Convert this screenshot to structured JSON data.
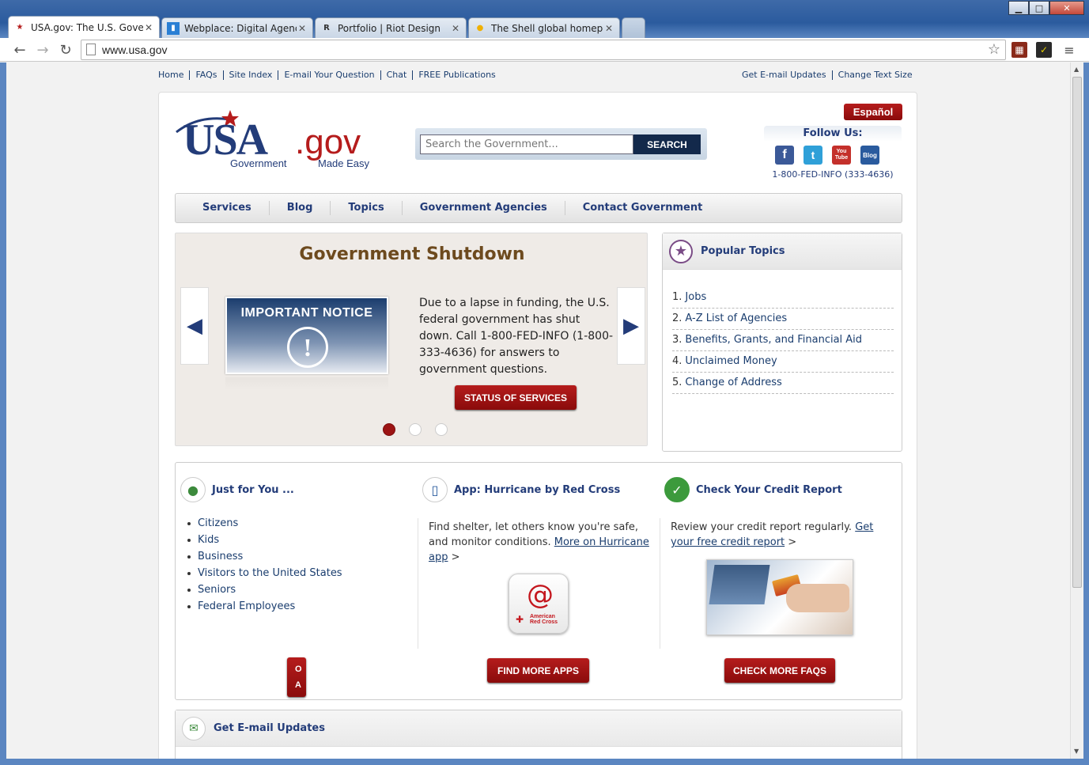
{
  "browser": {
    "tabs": [
      {
        "title": "USA.gov: The U.S. Govern",
        "active": true,
        "favicon": "usagov-favicon"
      },
      {
        "title": "Webplace: Digital Agency",
        "active": false,
        "favicon": "webplace-favicon"
      },
      {
        "title": "Portfolio | Riot Design",
        "active": false,
        "favicon": "riot-favicon"
      },
      {
        "title": "The Shell global homepag",
        "active": false,
        "favicon": "shell-favicon"
      }
    ],
    "url": "www.usa.gov",
    "window_controls": {
      "minimize": "▁",
      "maximize": "□",
      "close": "✕"
    }
  },
  "utility_nav": {
    "left": [
      "Home",
      "FAQs",
      "Site Index",
      "E-mail Your Question",
      "Chat",
      "FREE Publications"
    ],
    "right": [
      "Get E-mail Updates",
      "Change Text Size"
    ]
  },
  "header": {
    "espanol": "Español",
    "logo": {
      "usa": "USA",
      "gov": ".gov",
      "tag_left": "Government",
      "tag_right": "Made Easy"
    },
    "search": {
      "placeholder": "Search the Government...",
      "button": "SEARCH"
    },
    "follow": {
      "title": "Follow Us:",
      "phone": "1-800-FED-INFO (333-4636)",
      "icons": [
        "facebook-icon",
        "twitter-icon",
        "youtube-icon",
        "blog-icon"
      ],
      "youtube_label": "You Tube",
      "blog_label": "Blog"
    }
  },
  "main_nav": [
    "Services",
    "Blog",
    "Topics",
    "Government Agencies",
    "Contact Government"
  ],
  "hero": {
    "title": "Government Shutdown",
    "notice_title": "IMPORTANT NOTICE",
    "notice_symbol": "!",
    "text": "Due to a lapse in funding, the U.S. federal government has shut down. Call 1-800-FED-INFO (1-800-333-4636) for answers to government questions.",
    "button": "STATUS OF SERVICES",
    "slides": 3,
    "current_slide": 1
  },
  "popular_topics": {
    "title": "Popular Topics",
    "items": [
      "Jobs",
      "A-Z List of Agencies",
      "Benefits, Grants, and Financial Aid",
      "Unclaimed Money",
      "Change of Address"
    ]
  },
  "just_for_you": {
    "title": "Just for You ...",
    "items": [
      "Citizens",
      "Kids",
      "Business",
      "Visitors to the United States",
      "Seniors",
      "Federal Employees"
    ],
    "button": "MO AU"
  },
  "hurricane_app": {
    "title": "App: Hurricane by Red Cross",
    "desc": "Find shelter, let others know you're safe, and monitor conditions.",
    "link": "More on Hurricane app",
    "app_label": "American Red Cross",
    "button": "FIND MORE APPS"
  },
  "credit_report": {
    "title": "Check Your Credit Report",
    "desc": "Review your credit report regularly.",
    "link": "Get your free credit report",
    "button": "CHECK MORE FAQS"
  },
  "email_updates": {
    "title": "Get E-mail Updates"
  },
  "colors": {
    "brand_blue": "#233c79",
    "brand_red": "#b51c1c"
  }
}
